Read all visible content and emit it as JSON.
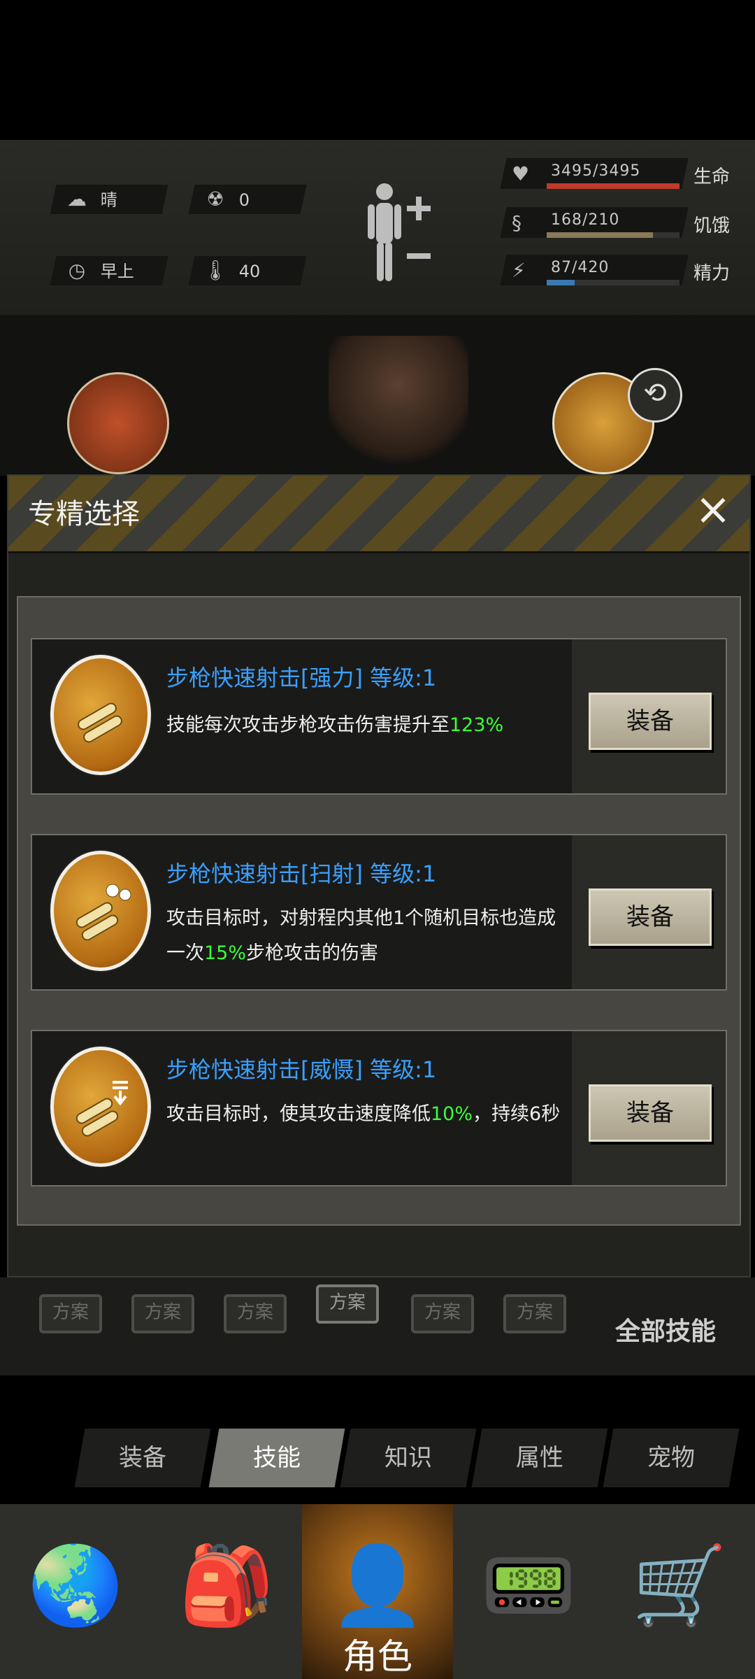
{
  "status": {
    "weather": "晴",
    "radiation": "0",
    "time_of_day": "早上",
    "temperature": "40",
    "health": {
      "value": "3495/3495",
      "label": "生命",
      "fraction": 1.0,
      "color": "#c0392b"
    },
    "hunger": {
      "value": "168/210",
      "label": "饥饿",
      "fraction": 0.8,
      "color": "#8a7a5a"
    },
    "energy": {
      "value": "87/420",
      "label": "精力",
      "fraction": 0.21,
      "color": "#3a7ab0"
    }
  },
  "modal": {
    "title": "专精选择",
    "close_icon": "×",
    "skills": [
      {
        "title": "步枪快速射击[强力]  等级:1",
        "desc_before": "技能每次攻击步枪攻击伤害提升至",
        "highlight": "123%",
        "desc_after": "",
        "equip_label": "装备"
      },
      {
        "title": "步枪快速射击[扫射]  等级:1",
        "desc_before": "攻击目标时，对射程内其他1个随机目标也造成一次",
        "highlight": "15%",
        "desc_after": "步枪攻击的伤害",
        "equip_label": "装备"
      },
      {
        "title": "步枪快速射击[威慑]  等级:1",
        "desc_before": "攻击目标时，使其攻击速度降低",
        "highlight": "10%",
        "desc_after": "，持续6秒",
        "equip_label": "装备"
      }
    ]
  },
  "plans": {
    "labels": [
      "方案",
      "方案",
      "方案",
      "方案",
      "方案",
      "方案"
    ],
    "all_skills": "全部技能"
  },
  "subtabs": [
    "装备",
    "技能",
    "知识",
    "属性",
    "宠物"
  ],
  "active_subtab": 1,
  "bottom_nav": {
    "active_label": "角色",
    "items": [
      "globe-icon",
      "backpack-icon",
      "character-icon",
      "radio-icon",
      "cart-icon"
    ]
  }
}
